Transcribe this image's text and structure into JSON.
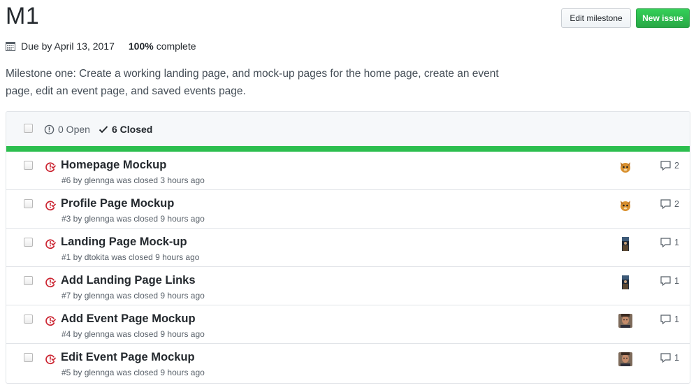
{
  "milestone": {
    "title": "M1",
    "due": "Due by April 13, 2017",
    "percent": "100%",
    "percent_label": "complete",
    "progress_fraction": 1.0,
    "description": "Milestone one: Create a working landing page, and mock-up pages for the home page, create an event page, edit an event page, and saved events page."
  },
  "buttons": {
    "edit": "Edit milestone",
    "new_issue": "New issue"
  },
  "states": {
    "open": "0 Open",
    "closed": "6 Closed"
  },
  "colors": {
    "progress": "#2cbe4e",
    "closed_icon": "#cb2431",
    "new_button": "#28a745"
  },
  "issues": [
    {
      "title": "Homepage Mockup",
      "meta": "#6 by glennga was closed 3 hours ago",
      "comments": "2",
      "avatar": "cat-avatar"
    },
    {
      "title": "Profile Page Mockup",
      "meta": "#3 by glennga was closed 9 hours ago",
      "comments": "2",
      "avatar": "cat-avatar"
    },
    {
      "title": "Landing Page Mock-up",
      "meta": "#1 by dtokita was closed 9 hours ago",
      "comments": "1",
      "avatar": "photo-avatar"
    },
    {
      "title": "Add Landing Page Links",
      "meta": "#7 by glennga was closed 9 hours ago",
      "comments": "1",
      "avatar": "photo-avatar"
    },
    {
      "title": "Add Event Page Mockup",
      "meta": "#4 by glennga was closed 9 hours ago",
      "comments": "1",
      "avatar": "face-avatar"
    },
    {
      "title": "Edit Event Page Mockup",
      "meta": "#5 by glennga was closed 9 hours ago",
      "comments": "1",
      "avatar": "face-avatar"
    }
  ]
}
